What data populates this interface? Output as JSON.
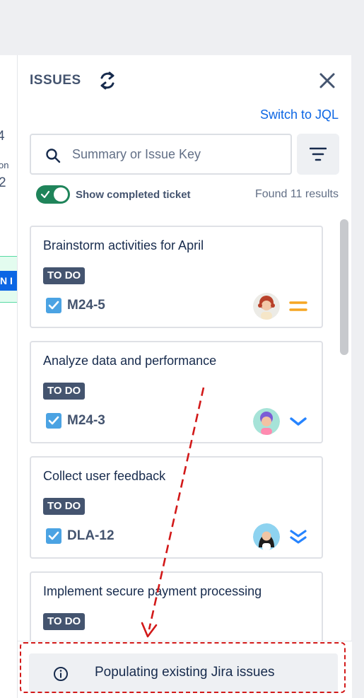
{
  "background": {
    "left_fragments": [
      "4",
      "on",
      "2"
    ]
  },
  "panel": {
    "title": "ISSUES",
    "switch_link": "Switch to JQL",
    "search": {
      "placeholder": "Summary or Issue Key",
      "value": ""
    },
    "toggle": {
      "label": "Show completed ticket",
      "on": true
    },
    "found_text": "Found 11 results",
    "issues": [
      {
        "summary": "Brainstorm activities for April",
        "status": "TO DO",
        "key": "M24-5",
        "priority": "medium",
        "avatar": "avatar-red-hair"
      },
      {
        "summary": "Analyze data and performance",
        "status": "TO DO",
        "key": "M24-3",
        "priority": "low",
        "avatar": "avatar-purple-hair"
      },
      {
        "summary": "Collect user feedback",
        "status": "TO DO",
        "key": "DLA-12",
        "priority": "lowest",
        "avatar": "avatar-dark-hair"
      },
      {
        "summary": "Implement secure payment processing",
        "status": "TO DO",
        "key": "",
        "priority": "",
        "avatar": ""
      }
    ],
    "banner": {
      "text": "Populating existing Jira issues"
    }
  },
  "colors": {
    "accent": "#0c66e4",
    "toggle_on": "#1f845a",
    "status_badge": "#44546f",
    "annotation": "#d21919",
    "priority_medium": "#f5a623",
    "priority_low": "#2684ff"
  }
}
